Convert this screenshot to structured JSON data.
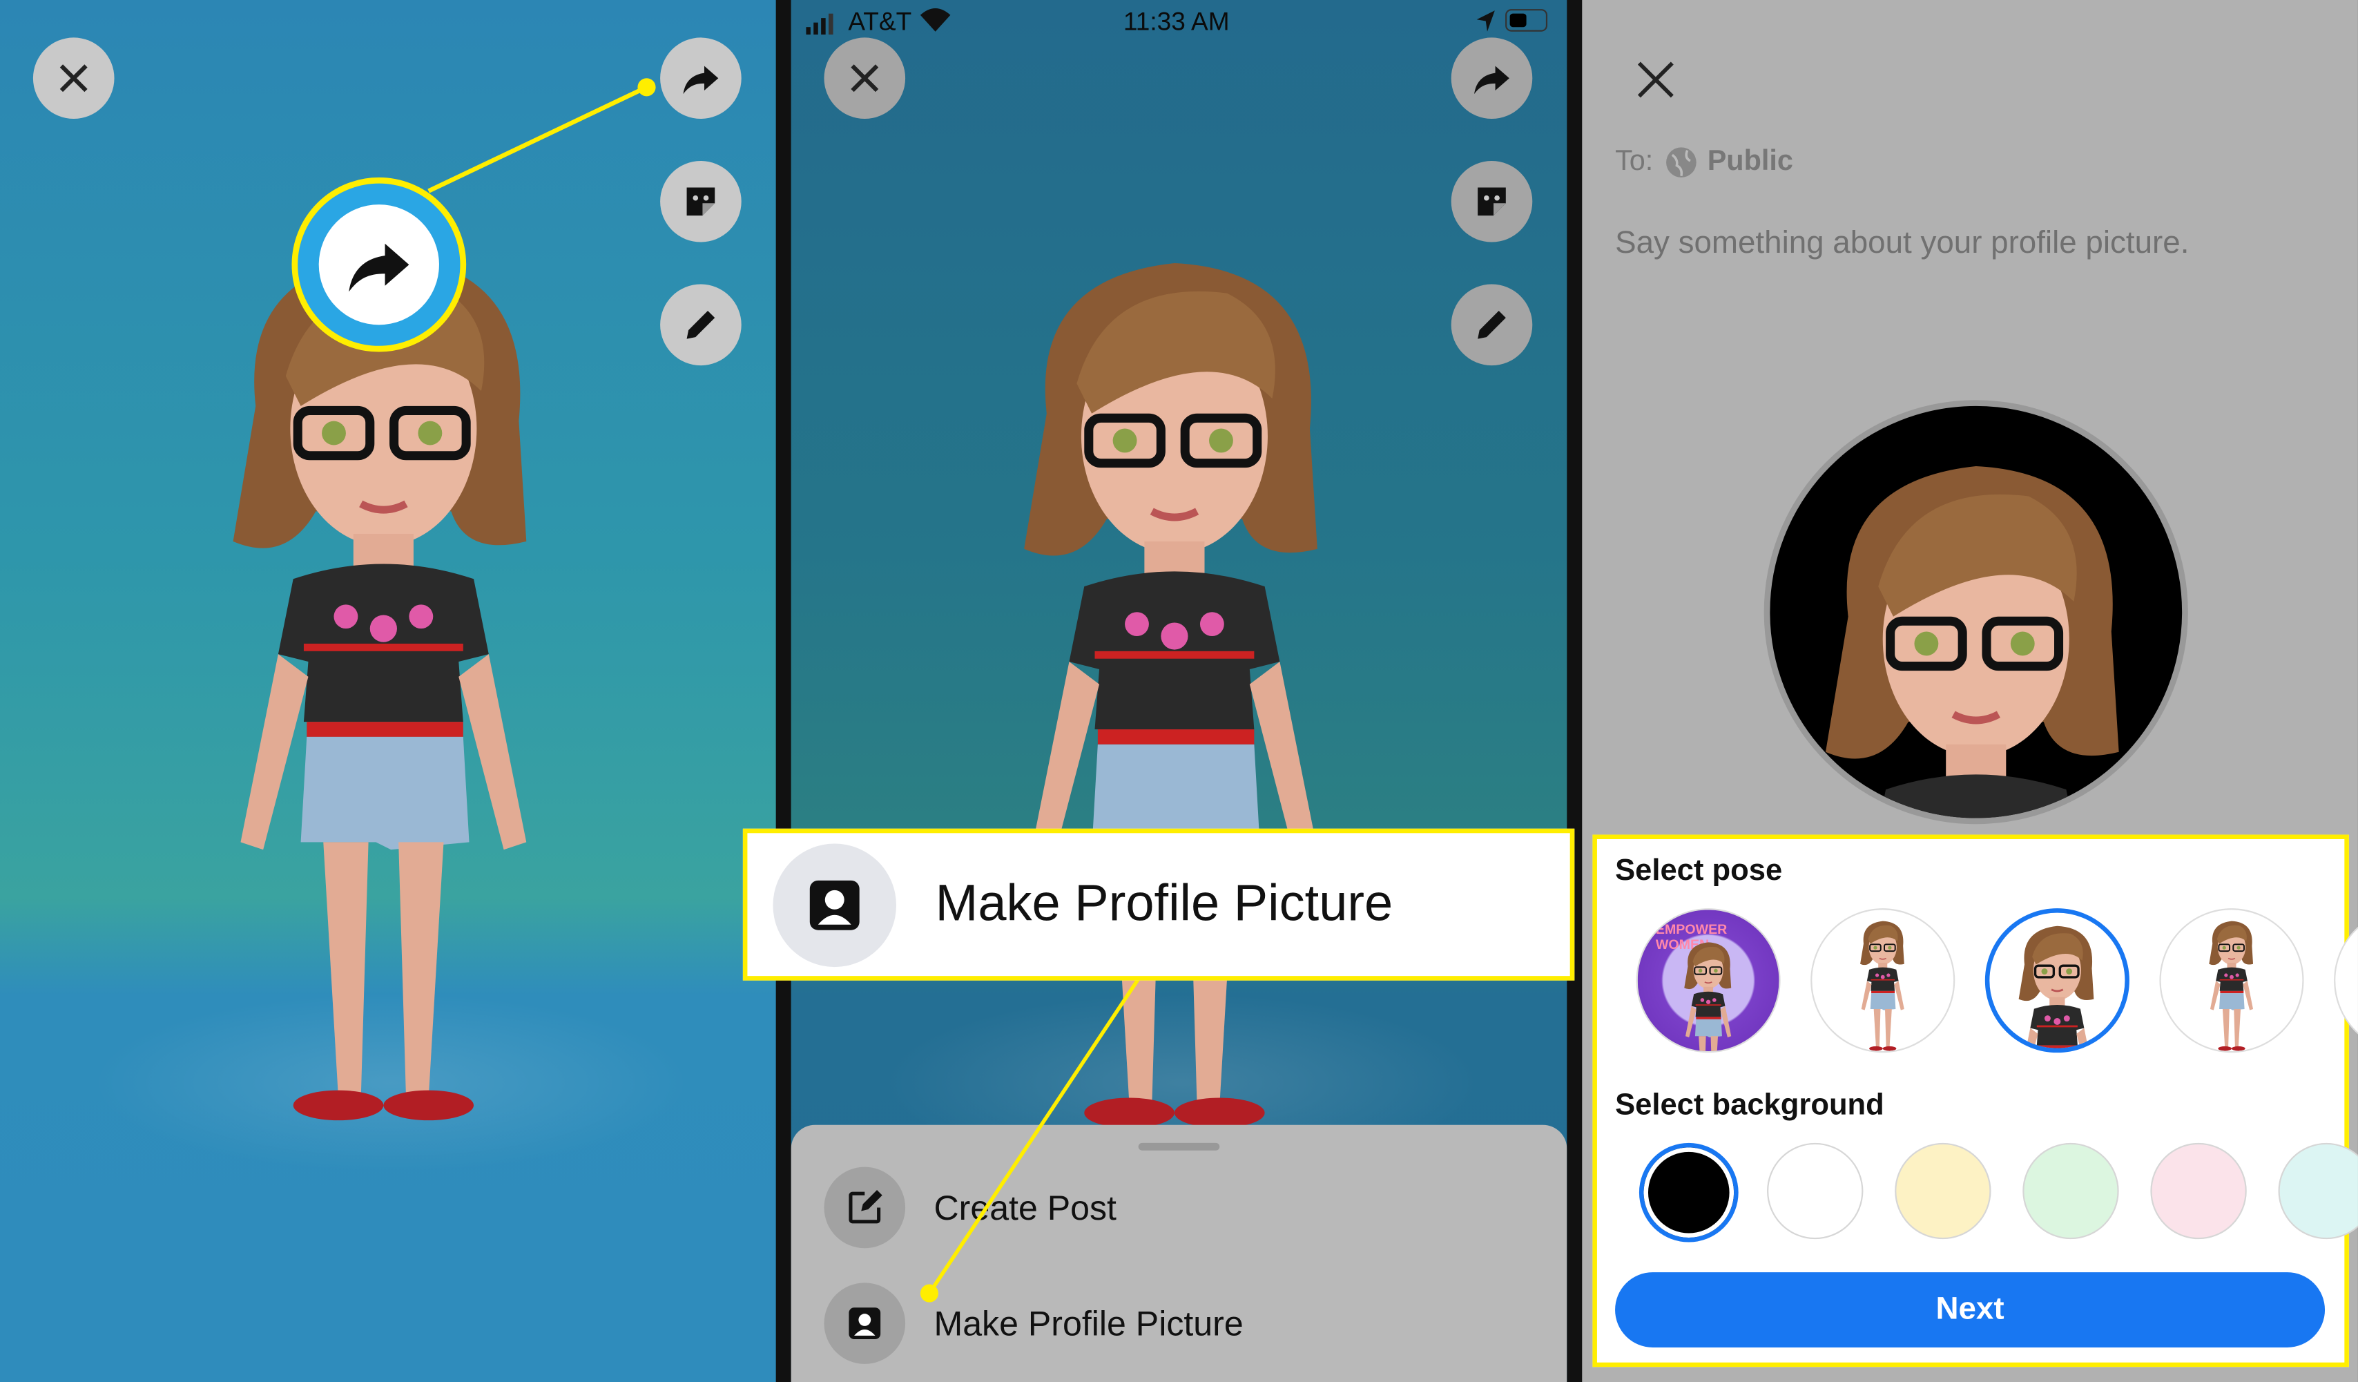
{
  "panel1": {
    "buttons": [
      "close-icon",
      "share-icon",
      "sticker-icon",
      "pencil-icon"
    ]
  },
  "panel2": {
    "status_bar": {
      "carrier": "AT&T",
      "time": "11:33 AM"
    },
    "sheet": {
      "items": [
        {
          "label": "Create Post",
          "icon": "edit-icon"
        },
        {
          "label": "Make Profile Picture",
          "icon": "profile-picture-icon"
        }
      ]
    },
    "callout": {
      "label": "Make Profile Picture"
    }
  },
  "panel3": {
    "audience_prefix": "To:",
    "audience": "Public",
    "caption_placeholder": "Say something about your profile picture.",
    "select_pose_label": "Select pose",
    "poses": [
      {
        "badge_text": "EMPOWER WOMEN",
        "selected": false
      },
      {
        "selected": false
      },
      {
        "selected": true
      },
      {
        "selected": false
      }
    ],
    "select_background_label": "Select background",
    "backgrounds": [
      {
        "color": "#000000",
        "selected": true
      },
      {
        "color": "#ffffff",
        "selected": false
      },
      {
        "color": "#fdf2c4",
        "selected": false
      },
      {
        "color": "#dcf6e0",
        "selected": false
      },
      {
        "color": "#fbe3ea",
        "selected": false
      },
      {
        "color": "#dcf5f3",
        "selected": false
      }
    ],
    "next_label": "Next"
  },
  "colors": {
    "highlight": "#ffee00",
    "accent": "#1877f2"
  }
}
